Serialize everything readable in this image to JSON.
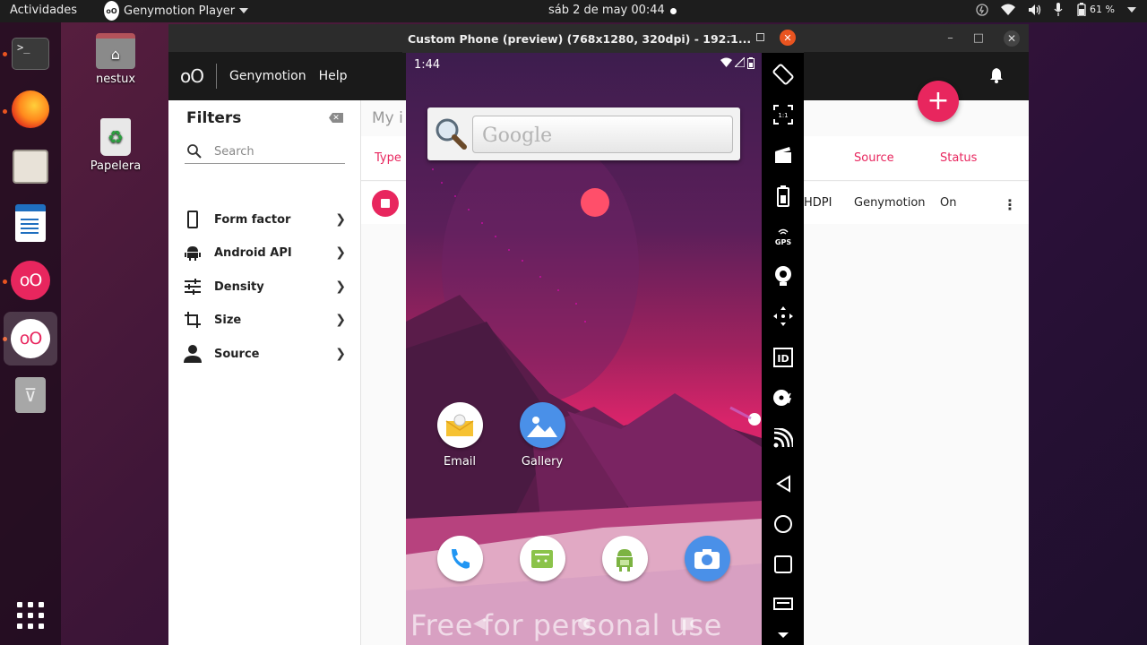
{
  "topbar": {
    "activities": "Actividades",
    "app_name": "Genymotion Player",
    "app_logo_text": "oO",
    "clock": "sáb  2 de may  00:44",
    "battery": "61 %",
    "icons": [
      "power-icon",
      "wifi-icon",
      "volume-icon",
      "microphone-icon",
      "battery-icon",
      "menu-arrow-icon"
    ]
  },
  "dock": {
    "items": [
      "terminal",
      "firefox",
      "files",
      "libreoffice-writer",
      "genymotion",
      "genymotion-player",
      "usb-drive",
      "show-applications"
    ],
    "terminal_prompt": ">_",
    "geny_text": "oO"
  },
  "desktop": {
    "home_label": "nestux",
    "trash_label": "Papelera"
  },
  "genymotion": {
    "logo": "oO",
    "menu": [
      "Genymotion",
      "Help"
    ],
    "fab_label": "+",
    "filters": {
      "title": "Filters",
      "search_placeholder": "Search",
      "items": [
        {
          "label": "Form factor",
          "icon": "phone-icon"
        },
        {
          "label": "Android API",
          "icon": "android-icon"
        },
        {
          "label": "Density",
          "icon": "sliders-icon"
        },
        {
          "label": "Size",
          "icon": "crop-icon"
        },
        {
          "label": "Source",
          "icon": "person-icon"
        }
      ]
    },
    "main": {
      "heading": "My i",
      "columns": {
        "type": "Type",
        "source": "Source",
        "status": "Status"
      },
      "row": {
        "density": "HDPI",
        "source": "Genymotion",
        "status": "On"
      }
    }
  },
  "emulator": {
    "title": "Custom Phone (preview) (768x1280, 320dpi) - 192.1...",
    "status_time": "1:44",
    "search_hint": "Google",
    "apps": [
      {
        "label": "Email",
        "icon": "email-icon"
      },
      {
        "label": "Gallery",
        "icon": "gallery-icon"
      }
    ],
    "hotseat": [
      "phone-icon",
      "messaging-icon",
      "android-market-icon",
      "camera-icon"
    ],
    "watermark": "Free for personal use",
    "toolbar": [
      "rotate-icon",
      "pixel-perfect-icon",
      "capture-icon",
      "battery-icon",
      "gps-icon",
      "webcam-icon",
      "navigation-icon",
      "identifiers-icon",
      "disk-io-icon",
      "network-icon",
      "back-icon",
      "home-icon",
      "recents-icon",
      "menu-icon",
      "chevron-down-icon"
    ]
  },
  "colors": {
    "accent": "#e8265e",
    "ubuntu_orange": "#e95420"
  }
}
